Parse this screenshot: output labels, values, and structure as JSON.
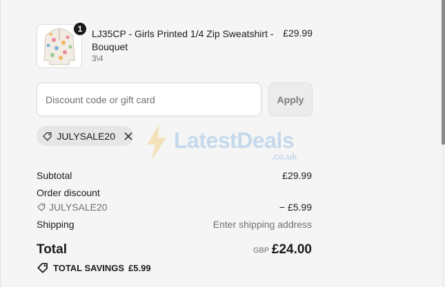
{
  "cart_item": {
    "name": "LJ35CP - Girls Printed 1/4 Zip Sweatshirt - Bouquet",
    "variant": "3\\4",
    "price": "£29.99",
    "quantity": "1",
    "thumb_icon": "sweatshirt-image"
  },
  "discount": {
    "placeholder": "Discount code or gift card",
    "value": "",
    "apply_label": "Apply",
    "applied_code": "JULYSALE20"
  },
  "watermark": {
    "text": "LatestDeals",
    "sub": ".co.uk"
  },
  "summary": {
    "subtotal_label": "Subtotal",
    "subtotal_value": "£29.99",
    "order_discount_label": "Order discount",
    "discount_code": "JULYSALE20",
    "discount_value": "− £5.99",
    "shipping_label": "Shipping",
    "shipping_value": "Enter shipping address",
    "total_label": "Total",
    "currency": "GBP",
    "total_value": "£24.00",
    "savings_label": "TOTAL SAVINGS",
    "savings_value": "£5.99"
  },
  "colors": {
    "panel_bg": "#f5f5f5",
    "text": "#1a1a1a",
    "muted": "#707070",
    "watermark": "#6fa8dc"
  }
}
